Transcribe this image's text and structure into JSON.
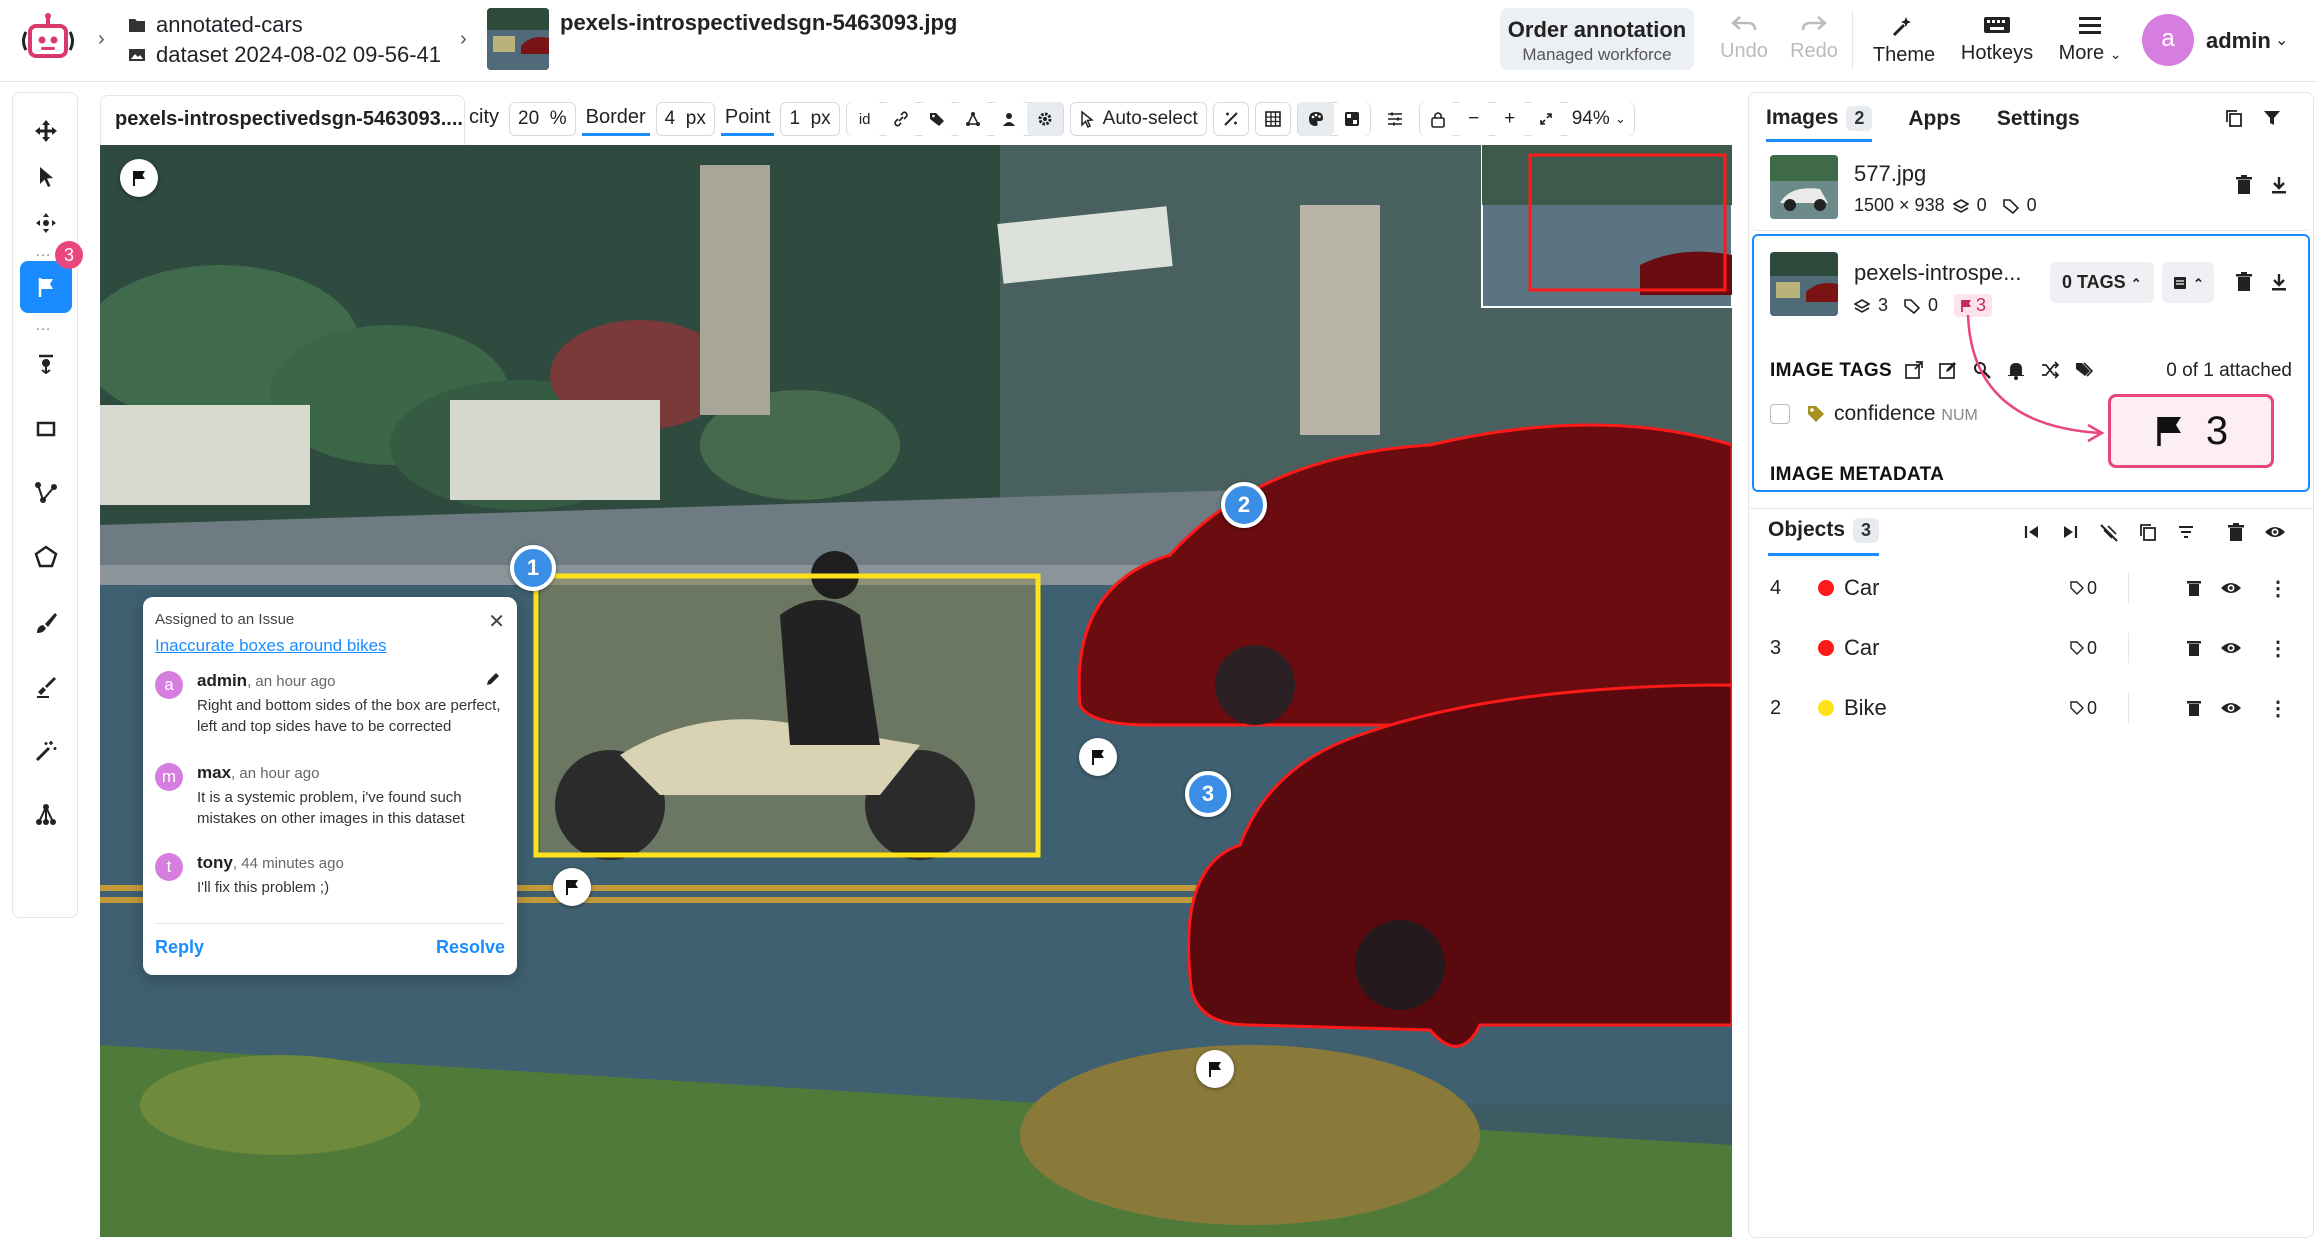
{
  "project": {
    "name": "annotated-cars",
    "dataset": "dataset 2024-08-02 09-56-41",
    "image_title": "pexels-introspectivedsgn-5463093.jpg"
  },
  "topbar": {
    "order_title": "Order annotation",
    "order_sub": "Managed workforce",
    "undo": "Undo",
    "redo": "Redo",
    "theme": "Theme",
    "hotkeys": "Hotkeys",
    "more": "More",
    "user_initial": "a",
    "user_name": "admin"
  },
  "rail": {
    "issues_count": "3",
    "tools": [
      "move-icon",
      "select-icon",
      "pan-icon",
      "flag-icon",
      "point-icon",
      "rectangle-icon",
      "polyline-icon",
      "polygon-icon",
      "brush-icon",
      "eraser-icon",
      "magic-wand-icon",
      "graph-icon"
    ]
  },
  "canvas_tab": {
    "name": "pexels-introspectivedsgn-5463093...."
  },
  "controls": {
    "opacity_label": "city",
    "opacity_value": "20",
    "opacity_unit": "%",
    "border_label": "Border",
    "border_value": "4",
    "border_unit": "px",
    "point_label": "Point",
    "point_value": "1",
    "point_unit": "px",
    "id_label": "id",
    "auto_select": "Auto-select",
    "zoom": "94%"
  },
  "issue": {
    "assigned": "Assigned to an Issue",
    "title": "Inaccurate boxes around bikes",
    "comments": [
      {
        "initial": "a",
        "author": "admin",
        "time": ", an hour ago",
        "text": "Right and bottom sides of the box are perfect, left and top sides have to be corrected",
        "color": "#d67de0"
      },
      {
        "initial": "m",
        "author": "max",
        "time": ", an hour ago",
        "text": "It is a systemic problem, i've found such mistakes on other images in this dataset",
        "color": "#d67de0"
      },
      {
        "initial": "t",
        "author": "tony",
        "time": ", 44 minutes ago",
        "text": "I'll fix this problem ;)",
        "color": "#d67de0"
      }
    ],
    "reply": "Reply",
    "resolve": "Resolve"
  },
  "markers": {
    "m1": "1",
    "m2": "2",
    "m3": "3"
  },
  "right_panel": {
    "tab_images": "Images",
    "images_count": "2",
    "tab_apps": "Apps",
    "tab_settings": "Settings",
    "image1": {
      "name": "577.jpg",
      "size": "1500 × 938",
      "layers": "0",
      "tags": "0"
    },
    "image2": {
      "name": "pexels-introspe...",
      "layers": "3",
      "tags": "0",
      "issues": "3",
      "tags_btn": "0 TAGS"
    },
    "image_tags_label": "IMAGE TAGS",
    "attached": "0 of 1 attached",
    "tag_name": "confidence",
    "tag_type": "NUM",
    "image_metadata_label": "IMAGE METADATA",
    "callout_count": "3",
    "objects_label": "Objects",
    "objects_count": "3",
    "objects": [
      {
        "id": "4",
        "class": "Car",
        "color": "#ff1a1a",
        "tags": "0"
      },
      {
        "id": "3",
        "class": "Car",
        "color": "#ff1a1a",
        "tags": "0"
      },
      {
        "id": "2",
        "class": "Bike",
        "color": "#ffe21a",
        "tags": "0"
      }
    ]
  },
  "colors": {
    "accent": "#1a8cff",
    "car": "#ff1a1a",
    "bike": "#ffe21a",
    "issue_pink": "#e8467c"
  }
}
